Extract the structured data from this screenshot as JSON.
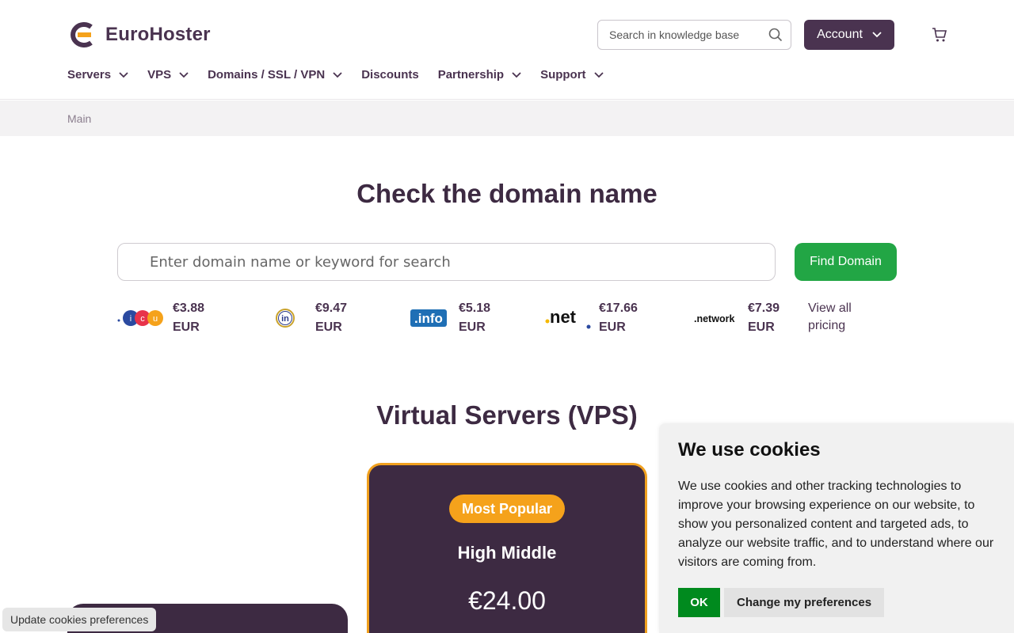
{
  "brand": {
    "name": "EuroHoster"
  },
  "kb_search": {
    "placeholder": "Search in knowledge base"
  },
  "account": {
    "label": "Account"
  },
  "nav": {
    "servers": "Servers",
    "vps": "VPS",
    "domains": "Domains / SSL / VPN",
    "discounts": "Discounts",
    "partnership": "Partnership",
    "support": "Support"
  },
  "breadcrumb": {
    "current": "Main"
  },
  "domain": {
    "title": "Check the domain name",
    "placeholder": "Enter domain name or keyword for search",
    "button": "Find Domain",
    "tlds": [
      {
        "logo": "icu",
        "price": "€3.88",
        "currency": "EUR"
      },
      {
        "logo": "in",
        "price": "€9.47",
        "currency": "EUR"
      },
      {
        "logo": ".info",
        "price": "€5.18",
        "currency": "EUR"
      },
      {
        "logo": ".net",
        "price": "€17.66",
        "currency": "EUR"
      },
      {
        "logo": ".network",
        "price": "€7.39",
        "currency": "EUR"
      }
    ],
    "view_all_1": "View all",
    "view_all_2": "pricing"
  },
  "vps": {
    "title": "Virtual Servers (VPS)",
    "popular": {
      "badge": "Most Popular",
      "name": "High Middle",
      "price": "€24.00"
    }
  },
  "cookie": {
    "title": "We use cookies",
    "text": "We use cookies and other tracking technologies to improve your browsing experience on our website, to show you personalized content and targeted ads, to analyze our website traffic, and to understand where our visitors are coming from.",
    "ok": "OK",
    "prefs": "Change my preferences",
    "update": "Update cookies preferences"
  },
  "colors": {
    "brand": "#4a3350",
    "accent": "#f5a21b",
    "cta": "#22a645",
    "ok": "#008a1e"
  }
}
